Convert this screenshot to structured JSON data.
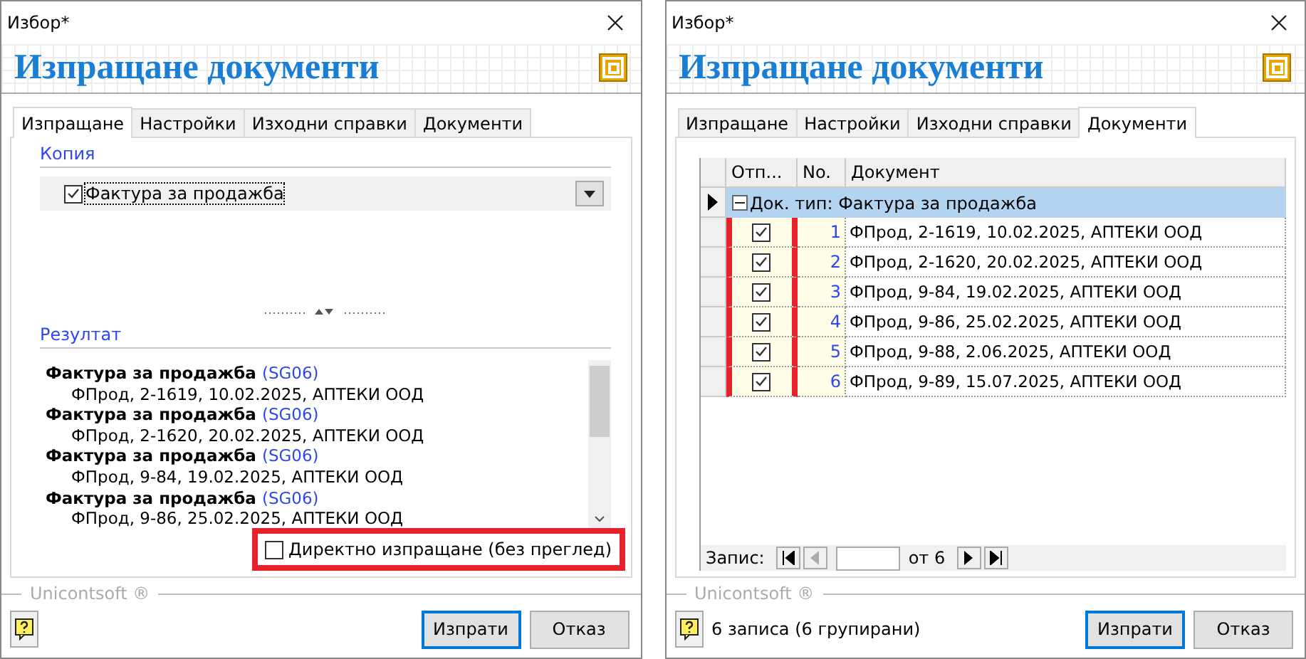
{
  "windows": [
    {
      "kind": "send",
      "title": "Избор*",
      "heading": "Изпращане документи",
      "tabs": [
        {
          "label": "Изпращане",
          "selected": true
        },
        {
          "label": "Настройки",
          "selected": false
        },
        {
          "label": "Изходни справки",
          "selected": false
        },
        {
          "label": "Документи",
          "selected": false
        }
      ],
      "copies": {
        "title": "Копия",
        "items": [
          {
            "label": "Фактура за продажба",
            "checked": true
          }
        ]
      },
      "result": {
        "title": "Резултат",
        "entries": [
          {
            "title": "Фактура за продажба",
            "code": "(SG06)",
            "detail": "ФПрод, 2-1619, 10.02.2025, АПТЕКИ ООД"
          },
          {
            "title": "Фактура за продажба",
            "code": "(SG06)",
            "detail": "ФПрод, 2-1620, 20.02.2025, АПТЕКИ ООД"
          },
          {
            "title": "Фактура за продажба",
            "code": "(SG06)",
            "detail": "ФПрод, 9-84, 19.02.2025, АПТЕКИ ООД"
          },
          {
            "title": "Фактура за продажба",
            "code": "(SG06)",
            "detail": "ФПрод, 9-86, 25.02.2025, АПТЕКИ ООД"
          }
        ]
      },
      "direct_send": {
        "label": "Директно изпращане (без преглед)",
        "checked": false,
        "highlighted": true
      },
      "brand": "Unicontsoft ®",
      "buttons": [
        {
          "label": "Изпрати",
          "default": true
        },
        {
          "label": "Отказ",
          "default": false
        }
      ]
    },
    {
      "kind": "documents",
      "title": "Избор*",
      "heading": "Изпращане документи",
      "tabs": [
        {
          "label": "Изпращане",
          "selected": false
        },
        {
          "label": "Настройки",
          "selected": false
        },
        {
          "label": "Изходни справки",
          "selected": false
        },
        {
          "label": "Документи",
          "selected": true
        }
      ],
      "grid": {
        "columns": [
          "Отп...",
          "No.",
          "Документ"
        ],
        "send_highlighted": true,
        "group": {
          "label": "Док. тип: Фактура за продажба",
          "expanded": true,
          "rows": [
            {
              "checked": true,
              "no": "1",
              "document": "ФПрод, 2-1619, 10.02.2025, АПТЕКИ ООД"
            },
            {
              "checked": true,
              "no": "2",
              "document": "ФПрод, 2-1620, 20.02.2025, АПТЕКИ ООД"
            },
            {
              "checked": true,
              "no": "3",
              "document": "ФПрод, 9-84, 19.02.2025, АПТЕКИ ООД"
            },
            {
              "checked": true,
              "no": "4",
              "document": "ФПрод, 9-86, 25.02.2025, АПТЕКИ ООД"
            },
            {
              "checked": true,
              "no": "5",
              "document": "ФПрод, 9-88, 2.06.2025, АПТЕКИ ООД"
            },
            {
              "checked": true,
              "no": "6",
              "document": "ФПрод, 9-89, 15.07.2025, АПТЕКИ ООД"
            }
          ]
        },
        "navigator": {
          "label": "Запис:",
          "total": "от 6"
        }
      },
      "status": "6 записа (6 групирани)",
      "brand": "Unicontsoft ®",
      "buttons": [
        {
          "label": "Изпрати",
          "default": true
        },
        {
          "label": "Отказ",
          "default": false
        }
      ]
    }
  ]
}
